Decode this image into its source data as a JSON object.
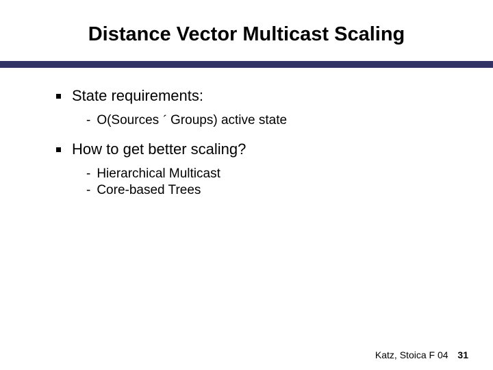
{
  "title": "Distance Vector Multicast Scaling",
  "items": [
    {
      "label": "State requirements:",
      "sub": [
        {
          "prefix": "O(Sources ",
          "mult": "´",
          "suffix": " Groups) active state"
        }
      ]
    },
    {
      "label": "How to get better scaling?",
      "sub": [
        {
          "text": "Hierarchical Multicast"
        },
        {
          "text": "Core-based Trees"
        }
      ]
    }
  ],
  "footer": {
    "attribution": "Katz, Stoica F 04",
    "page": "31"
  }
}
